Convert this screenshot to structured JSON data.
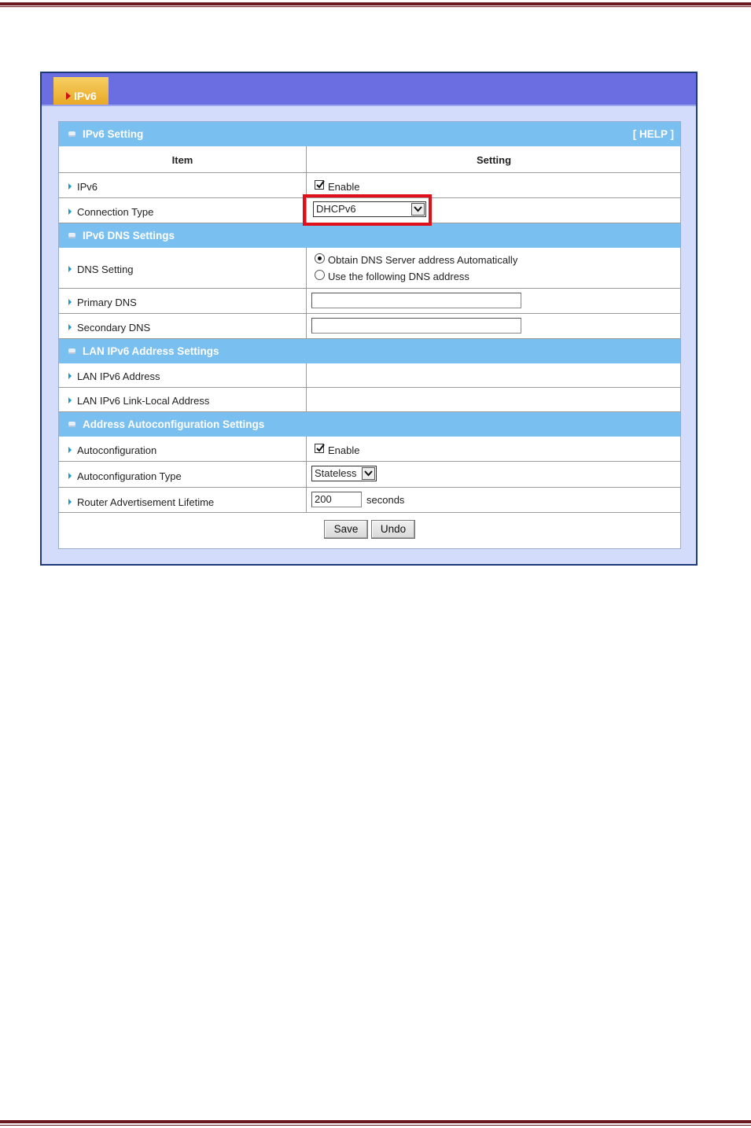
{
  "page": {
    "tab_label": "IPv6",
    "colors": {
      "rule": "#6b1a22",
      "topbar": "#6a6ee0",
      "tab": "#e9a925",
      "section": "#79bff0",
      "highlight": "#e0101a"
    }
  },
  "ipv6_setting": {
    "title": "IPv6 Setting",
    "help": "[ HELP ]",
    "col_item": "Item",
    "col_setting": "Setting",
    "ipv6_label": "IPv6",
    "ipv6_enable_label": "Enable",
    "ipv6_enabled": true,
    "conn_type_label": "Connection Type",
    "conn_type_value": "DHCPv6"
  },
  "dns": {
    "title": "IPv6 DNS Settings",
    "dns_setting_label": "DNS Setting",
    "option_auto": "Obtain DNS Server address Automatically",
    "option_manual": "Use the following DNS address",
    "selected": "auto",
    "primary_label": "Primary DNS",
    "primary_value": "",
    "secondary_label": "Secondary DNS",
    "secondary_value": ""
  },
  "lan": {
    "title": "LAN IPv6 Address Settings",
    "address_label": "LAN IPv6 Address",
    "linklocal_label": "LAN IPv6 Link-Local Address"
  },
  "autoconf": {
    "title": "Address Autoconfiguration Settings",
    "autoconf_label": "Autoconfiguration",
    "autoconf_enable_label": "Enable",
    "autoconf_enabled": true,
    "type_label": "Autoconfiguration Type",
    "type_value": "Stateless",
    "lifetime_label": "Router Advertisement Lifetime",
    "lifetime_value": "200",
    "lifetime_unit": "seconds"
  },
  "buttons": {
    "save": "Save",
    "undo": "Undo"
  }
}
